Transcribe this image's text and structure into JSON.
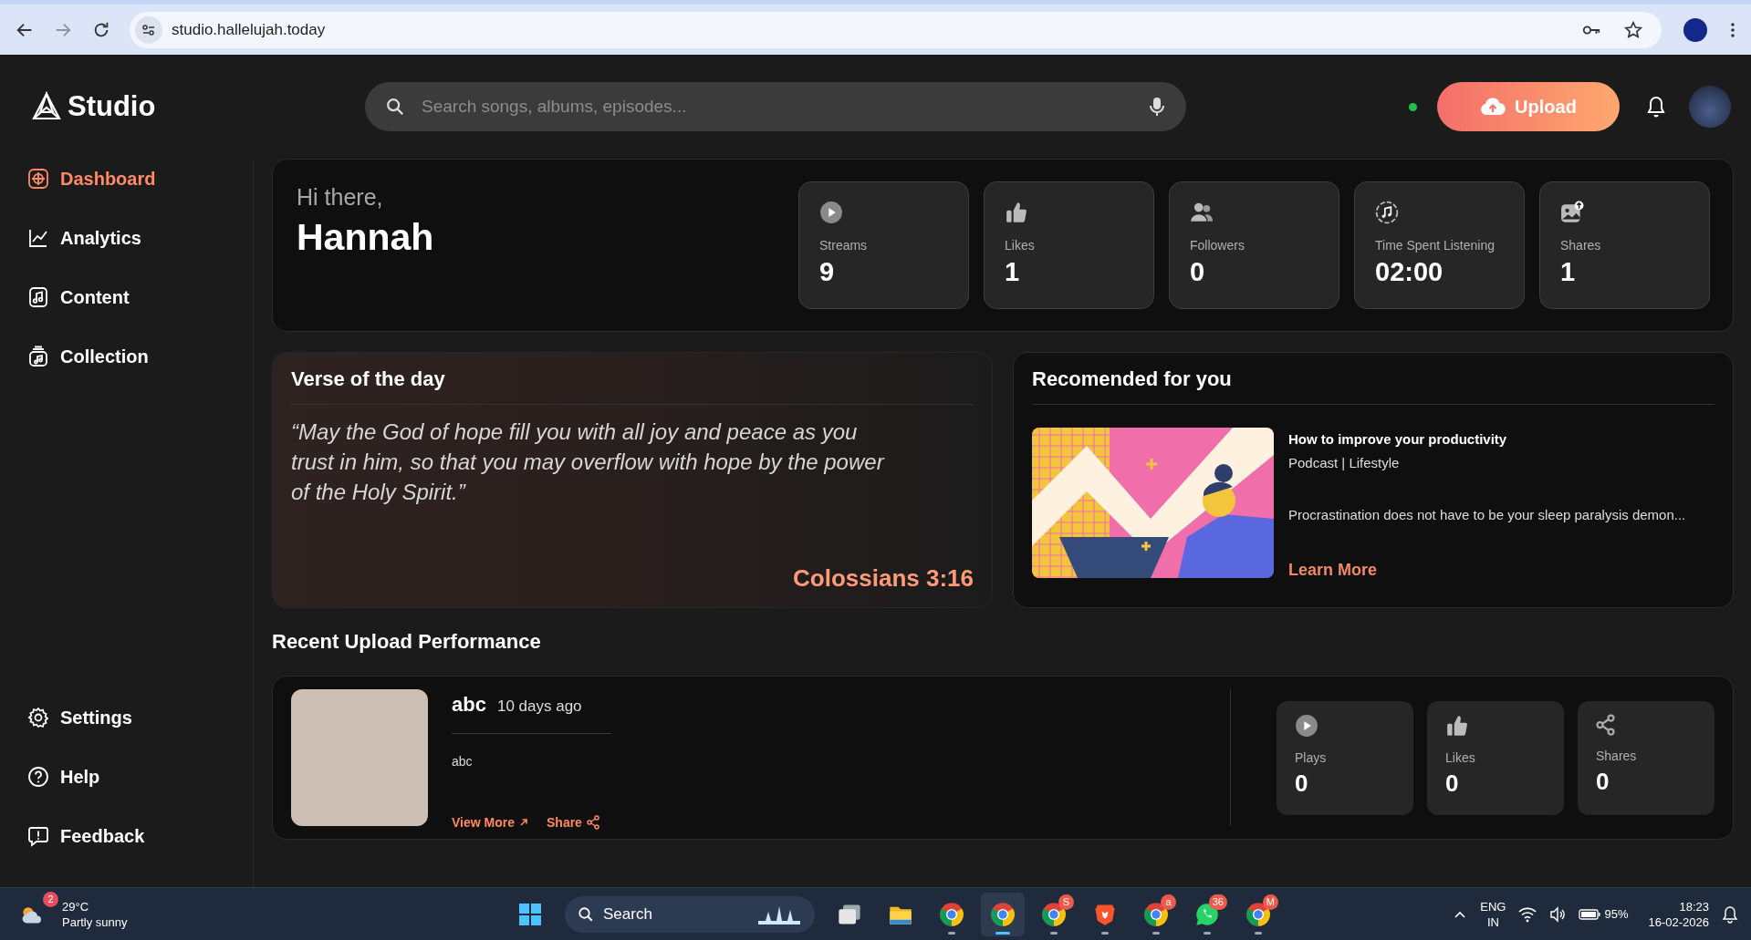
{
  "browser": {
    "nav": [
      {
        "kind": "back",
        "disabled": false
      },
      {
        "kind": "forward",
        "disabled": true
      },
      {
        "kind": "reload",
        "disabled": false
      }
    ],
    "url": "studio.hallelujah.today"
  },
  "header": {
    "brand": "Studio",
    "search_placeholder": "Search songs, albums, episodes...",
    "upload": "Upload",
    "online": true
  },
  "sidebar": {
    "items": [
      {
        "label": "Dashboard",
        "selected": true
      },
      {
        "label": "Analytics",
        "selected": false
      },
      {
        "label": "Content",
        "selected": false
      },
      {
        "label": "Collection",
        "selected": false
      }
    ],
    "bottom_items": [
      {
        "label": "Settings",
        "selected": false
      },
      {
        "label": "Help",
        "selected": false
      },
      {
        "label": "Feedback",
        "selected": false
      }
    ]
  },
  "greeting": {
    "hello": "Hi there,",
    "name": "Hannah"
  },
  "stats": [
    {
      "label": "Streams",
      "value": "9"
    },
    {
      "label": "Likes",
      "value": "1"
    },
    {
      "label": "Followers",
      "value": "0"
    },
    {
      "label": "Time Spent Listening",
      "value": "02:00"
    },
    {
      "label": "Shares",
      "value": "1"
    }
  ],
  "verse": {
    "title": "Verse of the day",
    "text": "“May the God of hope fill you with all joy and peace as you trust in him, so that you may overflow with hope by the power of the Holy Spirit.”",
    "reference": "Colossians 3:16"
  },
  "recommended": {
    "title": "Recomended for you",
    "item": {
      "title": "How to improve your productivity",
      "meta": "Podcast | Lifestyle",
      "description": "Procrastination does not have to be your sleep paralysis demon...",
      "link": "Learn More"
    }
  },
  "recent": {
    "title": "Recent Upload Performance",
    "upload": {
      "title": "abc",
      "age": "10 days ago",
      "description": "abc",
      "view_more": "View More",
      "share": "Share"
    },
    "stats": [
      {
        "label": "Plays",
        "value": "0"
      },
      {
        "label": "Likes",
        "value": "0"
      },
      {
        "label": "Shares",
        "value": "0"
      }
    ]
  },
  "taskbar": {
    "weather": {
      "badge": "2",
      "temperature": "29°C",
      "condition": "Partly sunny"
    },
    "search": "Search",
    "apps": [
      {
        "kind": "taskview",
        "selected": false,
        "running": false
      },
      {
        "kind": "explorer",
        "selected": false,
        "running": false
      },
      {
        "kind": "chrome",
        "selected": false,
        "running": true
      },
      {
        "kind": "chrome",
        "selected": true,
        "running": true
      },
      {
        "kind": "chrome",
        "selected": false,
        "running": true,
        "badge": "S"
      },
      {
        "kind": "brave",
        "selected": false,
        "running": true
      },
      {
        "kind": "chrome",
        "selected": false,
        "running": true,
        "badge": "a"
      },
      {
        "kind": "whatsapp",
        "selected": false,
        "running": true,
        "badge": "36"
      },
      {
        "kind": "chrome",
        "selected": false,
        "running": true,
        "badge": "M"
      }
    ],
    "tray": {
      "language": "ENG",
      "region": "IN",
      "battery": "95%",
      "time": "18:23",
      "date": "16-02-2026"
    }
  }
}
